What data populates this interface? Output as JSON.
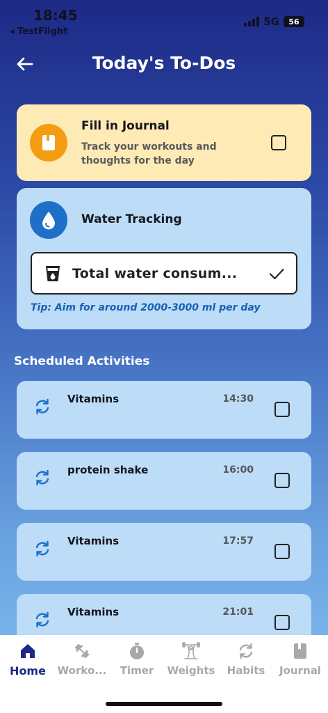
{
  "status_bar": {
    "time": "18:45",
    "back_app": "◂ TestFlight",
    "network": "5G",
    "battery": "56"
  },
  "header": {
    "title": "Today's To-Dos"
  },
  "journal": {
    "title": "Fill in Journal",
    "subtitle": "Track your workouts and thoughts for the day",
    "checked": false
  },
  "water": {
    "title": "Water Tracking",
    "input_value": "Total water consum...",
    "tip": "Tip: Aim for around 2000-3000 ml per day"
  },
  "scheduled": {
    "title": "Scheduled Activities",
    "items": [
      {
        "name": "Vitamins",
        "time": "14:30"
      },
      {
        "name": "protein shake",
        "time": "16:00"
      },
      {
        "name": "Vitamins",
        "time": "17:57"
      },
      {
        "name": "Vitamins",
        "time": "21:01"
      }
    ]
  },
  "tabs": [
    {
      "label": "Home",
      "icon": "home-icon",
      "active": true
    },
    {
      "label": "Worko...",
      "icon": "dumbbell-icon",
      "active": false
    },
    {
      "label": "Timer",
      "icon": "stopwatch-icon",
      "active": false
    },
    {
      "label": "Weights",
      "icon": "weightlifter-icon",
      "active": false
    },
    {
      "label": "Habits",
      "icon": "repeat-icon",
      "active": false
    },
    {
      "label": "Journal",
      "icon": "book-icon",
      "active": false
    }
  ],
  "colors": {
    "accent": "#1d2a86",
    "journal_card": "#fdeab5",
    "water_card": "#bcdcf7",
    "journal_icon_bg": "#f49c12",
    "water_icon_bg": "#1e6fc7",
    "tip_text": "#1a5fb5"
  }
}
